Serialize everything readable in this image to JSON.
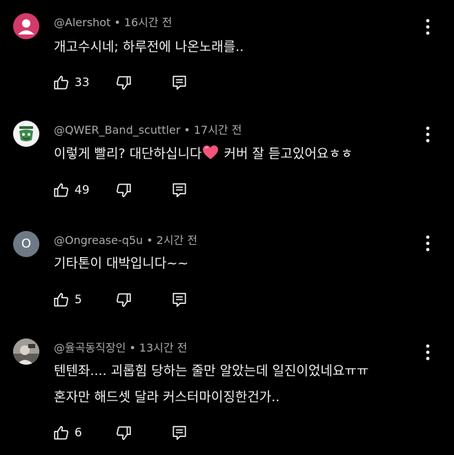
{
  "comments": [
    {
      "author": "@Alershot",
      "time": "16시간 전",
      "lines": [
        "개고수시네; 하루전에 나온노래를.."
      ],
      "likes": "33",
      "avatar": "default-person",
      "avatar_color": "#d23a6c"
    },
    {
      "author": "@QWER_Band_scuttler",
      "time": "17시간 전",
      "text_before": "이렇게 빨리? 대단하십니다",
      "text_after": " 커버 잘 듣고있어요ㅎㅎ",
      "emoji": "heart",
      "likes": "49",
      "avatar": "band-logo"
    },
    {
      "author": "@Ongrease-q5u",
      "time": "2시간 전",
      "lines": [
        "기타톤이 대박입니다~~"
      ],
      "likes": "5",
      "avatar_letter": "O",
      "avatar_color": "#6d7a86"
    },
    {
      "author": "@율곡동직장인",
      "time": "13시간 전",
      "lines": [
        "텐텐좌.... 괴롭힘 당하는 줄만 알았는데 일진이었네요ㅠㅠ",
        "혼자만 해드셋 달라 커스터마이징한건가.."
      ],
      "likes": "6",
      "avatar": "photo"
    }
  ],
  "separator": "•",
  "icons": {
    "like": "thumbs-up-icon",
    "dislike": "thumbs-down-icon",
    "reply": "reply-icon",
    "menu": "more-vertical-icon"
  }
}
